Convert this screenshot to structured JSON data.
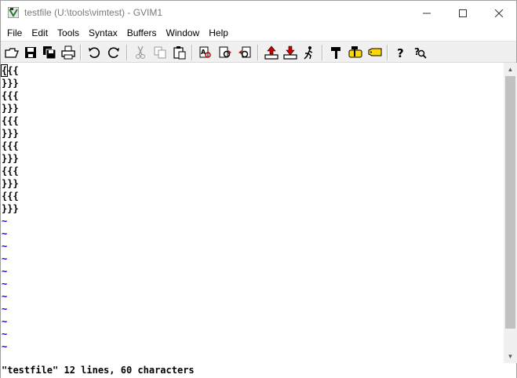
{
  "window": {
    "title": "testfile (U:\\tools\\vimtest) - GVIM1",
    "controls": {
      "minimize": "─",
      "maximize": "☐",
      "close": "✕"
    }
  },
  "menu": [
    "File",
    "Edit",
    "Tools",
    "Syntax",
    "Buffers",
    "Window",
    "Help"
  ],
  "toolbar": {
    "buttons": [
      "open-icon",
      "save-icon",
      "save-all-icon",
      "print-icon",
      "undo-icon",
      "redo-icon",
      "cut-icon",
      "copy-icon",
      "paste-icon",
      "find-replace-icon",
      "find-next-icon",
      "find-prev-icon",
      "load-session-icon",
      "save-session-icon",
      "run-script-icon",
      "make-icon",
      "build-tags-icon",
      "jump-tag-icon",
      "help-icon",
      "find-help-icon"
    ]
  },
  "editor": {
    "lines": [
      "{{{",
      "}}}",
      "{{{",
      "}}}",
      "{{{",
      "}}}",
      "{{{",
      "}}}",
      "{{{",
      "}}}",
      "{{{",
      "}}}"
    ],
    "cursor_line": 1,
    "cursor_col": 1,
    "empty_marker": "~",
    "empty_line_count": 11
  },
  "status": {
    "message": "\"testfile\" 12 lines, 60 characters"
  },
  "colors": {
    "tilde": "#0000ff",
    "toolbar_bg": "#f0f0f0",
    "scroll_thumb": "#c1c1c1"
  }
}
